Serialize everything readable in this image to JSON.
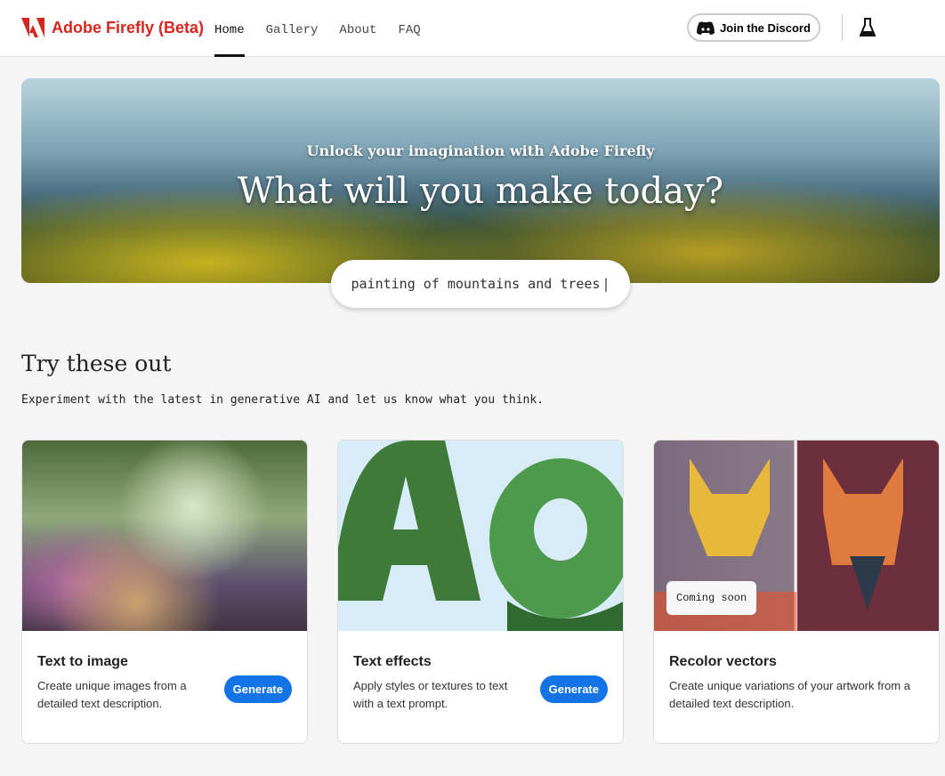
{
  "header": {
    "brand": "Adobe Firefly (Beta)",
    "nav": [
      {
        "label": "Home",
        "active": true
      },
      {
        "label": "Gallery"
      },
      {
        "label": "About"
      },
      {
        "label": "FAQ"
      }
    ],
    "discord_label": "Join the Discord",
    "icons": [
      "adobe-logo-icon",
      "discord-icon",
      "flask-icon"
    ],
    "brand_color": "#d7261e"
  },
  "hero": {
    "subtitle": "Unlock your imagination with Adobe Firefly",
    "title": "What will you make today?",
    "prompt_value": "painting of mountains and trees"
  },
  "section": {
    "title": "Try these out",
    "description": "Experiment with the latest in generative AI and let us know what you think."
  },
  "cards": [
    {
      "title": "Text to image",
      "description": "Create unique images from a detailed text description.",
      "button": "Generate"
    },
    {
      "title": "Text effects",
      "description": "Apply styles or textures to text with a text prompt.",
      "button": "Generate"
    },
    {
      "title": "Recolor vectors",
      "description": "Create unique variations of your artwork from a detailed text description.",
      "badge": "Coming soon"
    }
  ],
  "accent_color": "#1473e6"
}
